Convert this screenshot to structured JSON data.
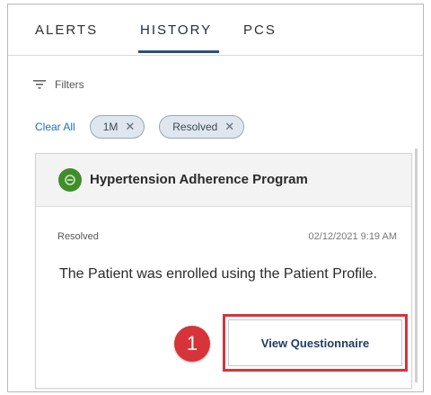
{
  "tabs": [
    {
      "label": "ALERTS",
      "active": false
    },
    {
      "label": "HISTORY",
      "active": true
    },
    {
      "label": "PCS",
      "active": false
    }
  ],
  "filters": {
    "label": "Filters",
    "icon": "filter-icon",
    "clear_all": "Clear All",
    "chips": [
      {
        "label": "1M",
        "remove": "✕"
      },
      {
        "label": "Resolved",
        "remove": "✕"
      }
    ]
  },
  "card": {
    "program_icon": "program-badge-icon",
    "program_title": "Hypertension Adherence Program",
    "status": "Resolved",
    "timestamp": "02/12/2021 9:19 AM",
    "message": "The Patient was enrolled using the Patient Profile.",
    "action_label": "View Questionnaire"
  },
  "callout": {
    "number": "1",
    "color": "#d6343a"
  },
  "colors": {
    "accent": "#2b5277",
    "link": "#1f6fbf",
    "program_green": "#3e8e2a"
  }
}
